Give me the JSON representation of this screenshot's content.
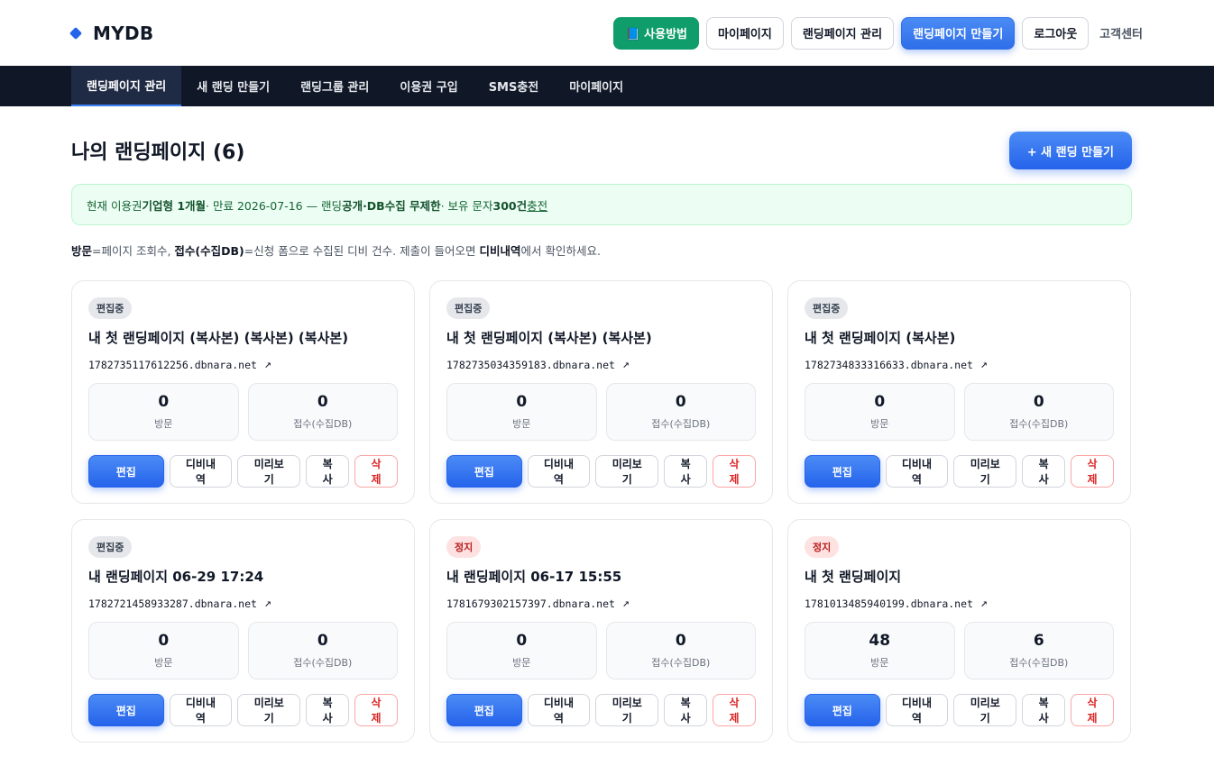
{
  "brand": {
    "name": "MYDB"
  },
  "header": {
    "guide": "📘 사용방법",
    "mypage": "마이페이지",
    "manage": "랜딩페이지 관리",
    "create": "랜딩페이지 만들기",
    "logout": "로그아웃",
    "support": "고객센터"
  },
  "nav": [
    "랜딩페이지 관리",
    "새 랜딩 만들기",
    "랜딩그룹 관리",
    "이용권 구입",
    "SMS충전",
    "마이페이지"
  ],
  "page": {
    "title": "나의 랜딩페이지 (6)",
    "new_button": "+ 새 랜딩 만들기"
  },
  "notice": {
    "p1": "현재 이용권 ",
    "plan": "기업형 1개월",
    "p2": " · 만료 2026-07-16 — 랜딩 ",
    "limit": "공개·DB수집 무제한",
    "p3": " · 보유 문자 ",
    "sms": "300건",
    "p4": " ",
    "charge": "충전"
  },
  "legend": {
    "k1": "방문",
    "t1": "=페이지 조회수, ",
    "k2": "접수(수집DB)",
    "t2": "=신청 폼으로 수집된 디비 건수. 제출이 들어오면 ",
    "k3": "디비내역",
    "t3": "에서 확인하세요."
  },
  "labels": {
    "visits": "방문",
    "submissions": "접수(수집DB)",
    "edit": "편집",
    "db": "디비내역",
    "preview": "미리보기",
    "copy": "복사",
    "delete": "삭제"
  },
  "cards": [
    {
      "status": "편집중",
      "type": "edit",
      "title": "내 첫 랜딩페이지 (복사본) (복사본) (복사본)",
      "url": "1782735117612256.dbnara.net",
      "visits": "0",
      "submissions": "0"
    },
    {
      "status": "편집중",
      "type": "edit",
      "title": "내 첫 랜딩페이지 (복사본) (복사본)",
      "url": "1782735034359183.dbnara.net",
      "visits": "0",
      "submissions": "0"
    },
    {
      "status": "편집중",
      "type": "edit",
      "title": "내 첫 랜딩페이지 (복사본)",
      "url": "1782734833316633.dbnara.net",
      "visits": "0",
      "submissions": "0"
    },
    {
      "status": "편집중",
      "type": "edit",
      "title": "내 랜딩페이지 06-29 17:24",
      "url": "1782721458933287.dbnara.net",
      "visits": "0",
      "submissions": "0"
    },
    {
      "status": "정지",
      "type": "stop",
      "title": "내 랜딩페이지 06-17 15:55",
      "url": "1781679302157397.dbnara.net",
      "visits": "0",
      "submissions": "0"
    },
    {
      "status": "정지",
      "type": "stop",
      "title": "내 첫 랜딩페이지",
      "url": "1781013485940199.dbnara.net",
      "visits": "48",
      "submissions": "6"
    }
  ]
}
